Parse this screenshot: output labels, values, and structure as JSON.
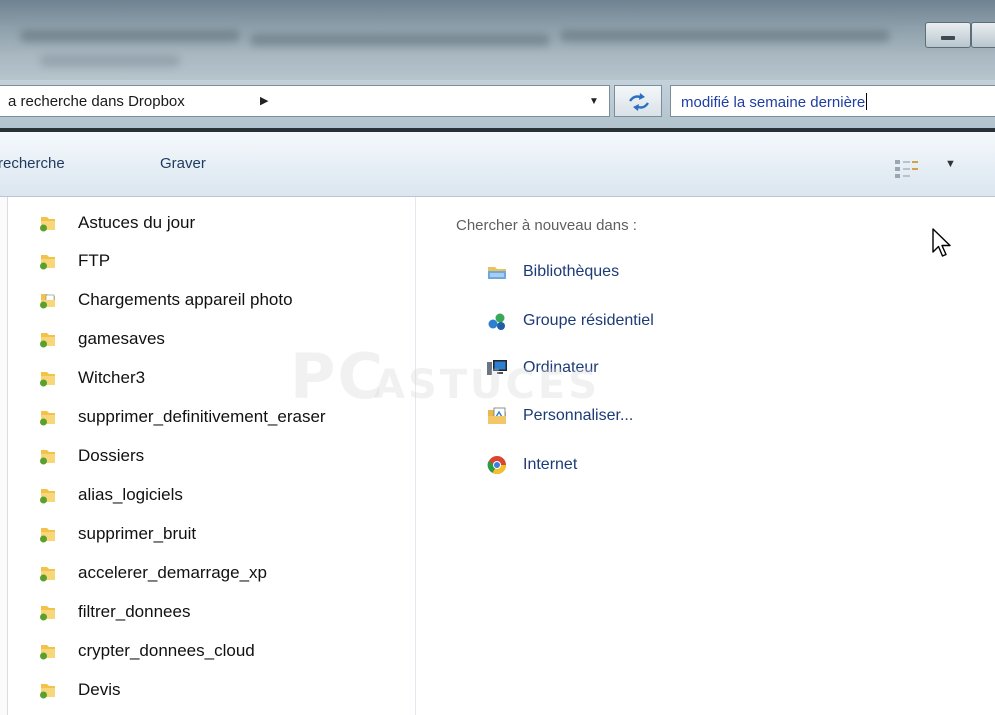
{
  "address_bar": {
    "breadcrumb": "a recherche dans Dropbox",
    "search_query": "modifié la semaine dernière"
  },
  "toolbar": {
    "items": [
      {
        "label": "recherche"
      },
      {
        "label": "Graver"
      }
    ]
  },
  "navigation": {
    "folders": [
      {
        "label": "Astuces du jour",
        "icon": "folder-icon"
      },
      {
        "label": "FTP",
        "icon": "folder-icon"
      },
      {
        "label": "Chargements appareil photo",
        "icon": "folder-document-icon"
      },
      {
        "label": "gamesaves",
        "icon": "folder-icon"
      },
      {
        "label": "Witcher3",
        "icon": "folder-icon"
      },
      {
        "label": "supprimer_definitivement_eraser",
        "icon": "folder-icon"
      },
      {
        "label": "Dossiers",
        "icon": "folder-icon"
      },
      {
        "label": "alias_logiciels",
        "icon": "folder-icon"
      },
      {
        "label": "supprimer_bruit",
        "icon": "folder-icon"
      },
      {
        "label": "accelerer_demarrage_xp",
        "icon": "folder-icon"
      },
      {
        "label": "filtrer_donnees",
        "icon": "folder-icon"
      },
      {
        "label": "crypter_donnees_cloud",
        "icon": "folder-icon"
      },
      {
        "label": "Devis",
        "icon": "folder-icon"
      }
    ]
  },
  "content": {
    "search_again_label": "Chercher à nouveau dans :",
    "locations": [
      {
        "label": "Bibliothèques",
        "icon": "libraries-icon"
      },
      {
        "label": "Groupe résidentiel",
        "icon": "homegroup-icon"
      },
      {
        "label": "Ordinateur",
        "icon": "computer-icon"
      },
      {
        "label": "Personnaliser...",
        "icon": "customize-icon"
      },
      {
        "label": "Internet",
        "icon": "internet-icon"
      }
    ]
  },
  "watermark": {
    "text": "PC ASTUCES"
  },
  "colors": {
    "folder_yellow": "#f2c24a",
    "folder_green": "#5aa02c",
    "link_blue": "#1c3a76",
    "search_text": "#1f3ea3"
  }
}
